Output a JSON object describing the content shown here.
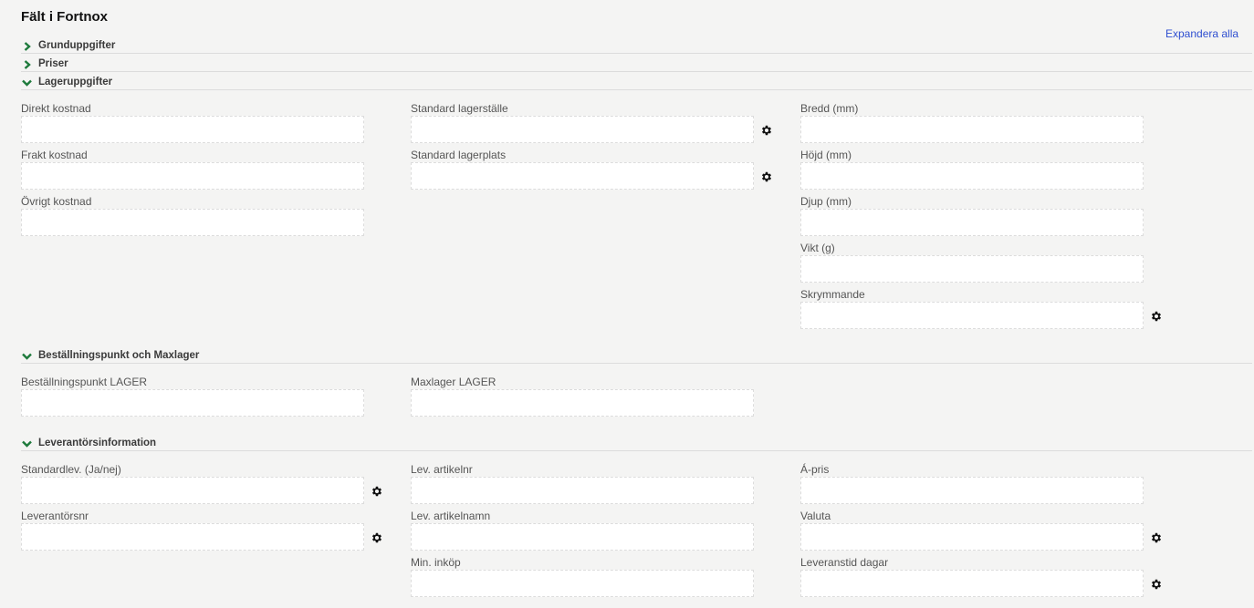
{
  "title": "Fält i Fortnox",
  "expand_all_label": "Expandera alla",
  "sections": {
    "grunduppgifter": {
      "label": "Grunduppgifter",
      "expanded": false
    },
    "priser": {
      "label": "Priser",
      "expanded": false
    },
    "lageruppgifter": {
      "label": "Lageruppgifter",
      "expanded": true,
      "fields": {
        "direkt_kostnad": "Direkt kostnad",
        "frakt_kostnad": "Frakt kostnad",
        "ovrigt_kostnad": "Övrigt kostnad",
        "standard_lagerstalle": "Standard lagerställe",
        "standard_lagerplats": "Standard lagerplats",
        "bredd": "Bredd (mm)",
        "hojd": "Höjd (mm)",
        "djup": "Djup (mm)",
        "vikt": "Vikt (g)",
        "skrymmande": "Skrymmande"
      }
    },
    "bestallningspunkt": {
      "label": "Beställningspunkt och Maxlager",
      "expanded": true,
      "fields": {
        "bestallningspunkt_lager": "Beställningspunkt LAGER",
        "maxlager_lager": "Maxlager LAGER"
      }
    },
    "leverantorsinformation": {
      "label": "Leverantörsinformation",
      "expanded": true,
      "fields": {
        "standardlev": "Standardlev. (Ja/nej)",
        "leverantorsnr": "Leverantörsnr",
        "lev_artikelnr": "Lev. artikelnr",
        "lev_artikelnamn": "Lev. artikelnamn",
        "min_inkop": "Min. inköp",
        "a_pris": "Á-pris",
        "valuta": "Valuta",
        "leveranstid_dagar": "Leveranstid dagar"
      }
    }
  },
  "colors": {
    "accent_green": "#1e7a3c",
    "link_blue": "#2f4fd0",
    "background": "#f4f4f3"
  },
  "icons": {
    "collapsed": "chevron-right-icon",
    "expanded": "chevron-down-icon",
    "settings": "gear-icon"
  }
}
